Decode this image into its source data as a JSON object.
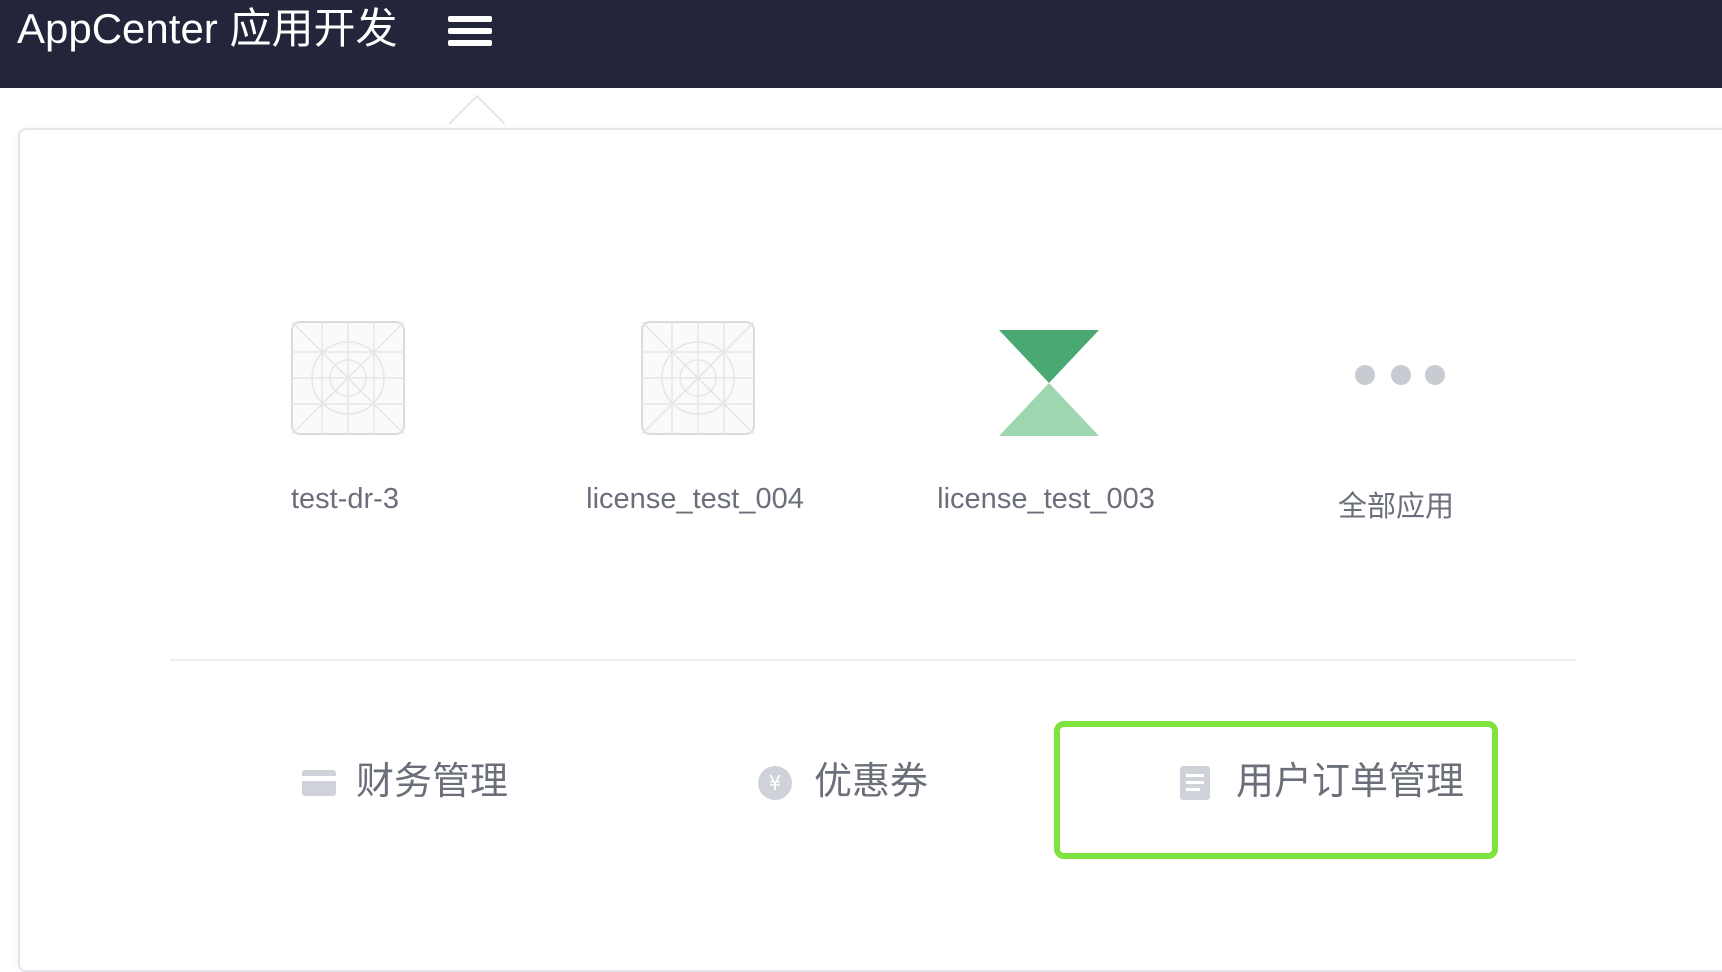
{
  "header": {
    "brand": "AppCenter 应用开发",
    "menu_icon": "hamburger-menu-icon"
  },
  "apps": [
    {
      "name": "test-dr-3",
      "icon": "placeholder-grid-icon"
    },
    {
      "name": "license_test_004",
      "icon": "placeholder-grid-icon"
    },
    {
      "name": "license_test_003",
      "icon": "hourglass-logo-icon"
    },
    {
      "name": "全部应用",
      "icon": "more-dots-icon"
    }
  ],
  "quick_links": [
    {
      "label": "财务管理",
      "icon": "card-icon"
    },
    {
      "label": "优惠券",
      "icon": "coupon-yen-icon"
    },
    {
      "label": "用户订单管理",
      "icon": "document-icon",
      "highlighted": true
    }
  ],
  "colors": {
    "topbar": "#23253a",
    "highlight": "#7ee33f",
    "logo_dark_green": "#4aa873",
    "logo_light_green": "#9ed6b0"
  }
}
